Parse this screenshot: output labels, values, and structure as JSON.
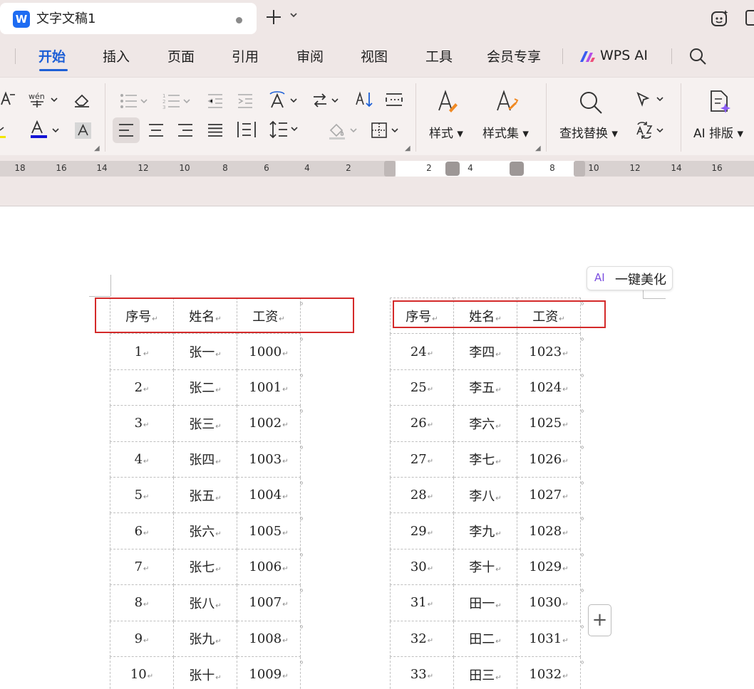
{
  "titlebar": {
    "app_logo": "W",
    "doc_title": "文字文稿1",
    "icons": [
      "app-logo-icon",
      "unsaved-dot-icon",
      "plus-icon",
      "chevron-down-icon",
      "ai-assistant-icon",
      "window-icon"
    ]
  },
  "menu": {
    "items": [
      "开始",
      "插入",
      "页面",
      "引用",
      "审阅",
      "视图",
      "工具",
      "会员专享"
    ],
    "active_index": 0,
    "wps_ai": "WPS AI",
    "accent": "#1d5fd6"
  },
  "ribbon": {
    "styles_label": "样式",
    "style_set_label": "样式集",
    "find_replace_label": "查找替换",
    "ai_layout_label": "AI 排版",
    "font_color": "#1414d6"
  },
  "ruler": {
    "left_numbers": [
      "18",
      "16",
      "14",
      "12",
      "10",
      "8",
      "6",
      "4",
      "2"
    ],
    "right_numbers": [
      "2",
      "4",
      "8",
      "10",
      "12",
      "14",
      "16"
    ]
  },
  "doc": {
    "beautify_ai": "AI",
    "beautify_label": "一键美化",
    "add_row": "+",
    "highlight_color": "#d42a2a",
    "para_mark": "↵",
    "cell_mark": "⁰",
    "left_table": {
      "header": [
        "序号",
        "姓名",
        "工资"
      ],
      "rows": [
        [
          "1",
          "张一",
          "1000"
        ],
        [
          "2",
          "张二",
          "1001"
        ],
        [
          "3",
          "张三",
          "1002"
        ],
        [
          "4",
          "张四",
          "1003"
        ],
        [
          "5",
          "张五",
          "1004"
        ],
        [
          "6",
          "张六",
          "1005"
        ],
        [
          "7",
          "张七",
          "1006"
        ],
        [
          "8",
          "张八",
          "1007"
        ],
        [
          "9",
          "张九",
          "1008"
        ],
        [
          "10",
          "张十",
          "1009"
        ]
      ]
    },
    "right_table": {
      "header": [
        "序号",
        "姓名",
        "工资"
      ],
      "rows": [
        [
          "24",
          "李四",
          "1023"
        ],
        [
          "25",
          "李五",
          "1024"
        ],
        [
          "26",
          "李六",
          "1025"
        ],
        [
          "27",
          "李七",
          "1026"
        ],
        [
          "28",
          "李八",
          "1027"
        ],
        [
          "29",
          "李九",
          "1028"
        ],
        [
          "30",
          "李十",
          "1029"
        ],
        [
          "31",
          "田一",
          "1030"
        ],
        [
          "32",
          "田二",
          "1031"
        ],
        [
          "33",
          "田三",
          "1032"
        ]
      ]
    }
  }
}
